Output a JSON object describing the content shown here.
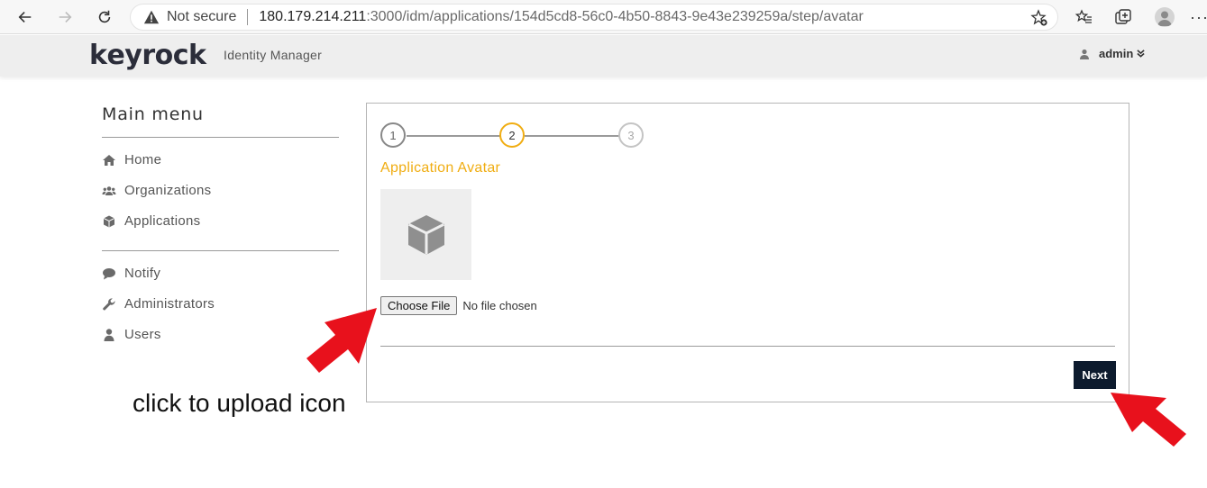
{
  "browser": {
    "not_secure_label": "Not secure",
    "url_host": "180.179.214.211",
    "url_path": ":3000/idm/applications/154d5cd8-56c0-4b50-8843-9e43e239259a/step/avatar",
    "more_label": "···"
  },
  "header": {
    "logo_k": "k",
    "logo_rest": "eyrock",
    "subtitle": "Identity Manager",
    "user_name": "admin",
    "user_caret": "»"
  },
  "sidebar": {
    "title": "Main menu",
    "items": [
      {
        "label": "Home",
        "icon": "home-icon"
      },
      {
        "label": "Organizations",
        "icon": "users-icon"
      },
      {
        "label": "Applications",
        "icon": "cube-icon"
      },
      {
        "label": "Notify",
        "icon": "comment-icon"
      },
      {
        "label": "Administrators",
        "icon": "wrench-icon"
      },
      {
        "label": "Users",
        "icon": "user-icon"
      }
    ]
  },
  "wizard": {
    "steps": [
      "1",
      "2",
      "3"
    ],
    "current_step": 2,
    "section_title": "Application Avatar",
    "choose_file_label": "Choose File",
    "no_file_label": "No file chosen",
    "next_label": "Next"
  },
  "annotations": {
    "upload_hint": "click to upload icon"
  },
  "colors": {
    "accent": "#f0ad12",
    "next_button": "#0d1b2e",
    "arrow": "#e8111c"
  }
}
